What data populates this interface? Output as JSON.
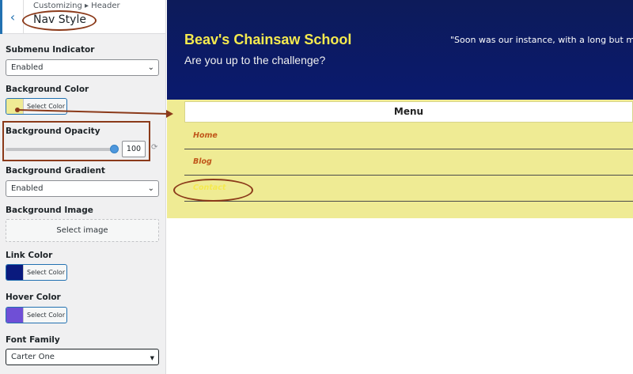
{
  "sidebar": {
    "breadcrumb": "Customizing ▸ Header",
    "title": "Nav Style",
    "back_icon": "‹",
    "submenu_indicator": {
      "label": "Submenu Indicator",
      "value": "Enabled"
    },
    "background_color": {
      "label": "Background Color",
      "button": "Select Color",
      "color": "#efeb94"
    },
    "background_opacity": {
      "label": "Background Opacity",
      "value": "100",
      "level": 1.0
    },
    "background_gradient": {
      "label": "Background Gradient",
      "value": "Enabled"
    },
    "background_image": {
      "label": "Background Image",
      "button": "Select image"
    },
    "link_color": {
      "label": "Link Color",
      "button": "Select Color",
      "color": "#0a1a7e"
    },
    "hover_color": {
      "label": "Hover Color",
      "button": "Select Color",
      "color": "#6f4fd6"
    },
    "font_family": {
      "label": "Font Family",
      "value": "Carter One"
    }
  },
  "preview": {
    "site_title": "Beav's Chainsaw School",
    "tagline": "Are you up to the challenge?",
    "quote": "\"Soon was our instance, with a long but much fo",
    "menu_label": "Menu",
    "nav_items": [
      "Home",
      "Blog",
      "Contact"
    ]
  },
  "colors": {
    "header_bg": "#0d1b5a",
    "title_yellow": "#f5ea4e",
    "nav_bg": "#efeb94",
    "link_orange": "#c0561a",
    "annotation": "#8b3a1a"
  }
}
